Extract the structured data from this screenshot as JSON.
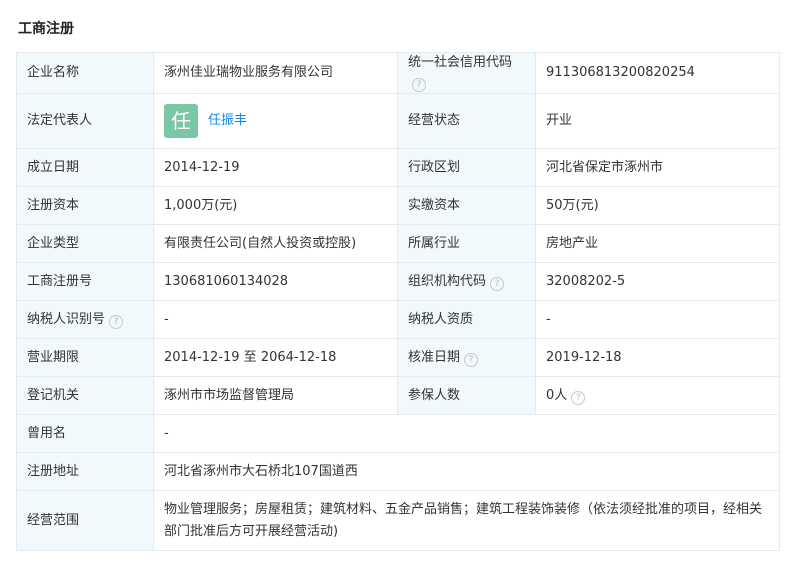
{
  "section_title": "工商注册",
  "rows": {
    "company_name": {
      "label": "企业名称",
      "value": "涿州佳业瑞物业服务有限公司"
    },
    "credit_code": {
      "label": "统一社会信用代码",
      "value": "911306813200820254"
    },
    "legal_rep": {
      "label": "法定代表人",
      "avatar_char": "任",
      "name": "任振丰"
    },
    "status": {
      "label": "经营状态",
      "value": "开业"
    },
    "found_date": {
      "label": "成立日期",
      "value": "2014-12-19"
    },
    "region": {
      "label": "行政区划",
      "value": "河北省保定市涿州市"
    },
    "reg_capital": {
      "label": "注册资本",
      "value": "1,000万(元)"
    },
    "paid_capital": {
      "label": "实缴资本",
      "value": "50万(元)"
    },
    "company_type": {
      "label": "企业类型",
      "value": "有限责任公司(自然人投资或控股)"
    },
    "industry": {
      "label": "所属行业",
      "value": "房地产业"
    },
    "reg_number": {
      "label": "工商注册号",
      "value": "130681060134028"
    },
    "org_code": {
      "label": "组织机构代码",
      "value": "32008202-5"
    },
    "taxpayer_id": {
      "label": "纳税人识别号",
      "value": "-"
    },
    "taxpayer_qual": {
      "label": "纳税人资质",
      "value": "-"
    },
    "biz_term": {
      "label": "营业期限",
      "value": "2014-12-19 至 2064-12-18"
    },
    "approve_date": {
      "label": "核准日期",
      "value": "2019-12-18"
    },
    "reg_authority": {
      "label": "登记机关",
      "value": "涿州市市场监督管理局"
    },
    "insured": {
      "label": "参保人数",
      "value": "0人"
    },
    "former_name": {
      "label": "曾用名",
      "value": "-"
    },
    "address": {
      "label": "注册地址",
      "value": "河北省涿州市大石桥北107国道西"
    },
    "scope": {
      "label": "经营范围",
      "value": "物业管理服务；房屋租赁；建筑材料、五金产品销售；建筑工程装饰装修（依法须经批准的项目，经相关部门批准后方可开展经营活动)"
    }
  },
  "help_icon_glyph": "?"
}
